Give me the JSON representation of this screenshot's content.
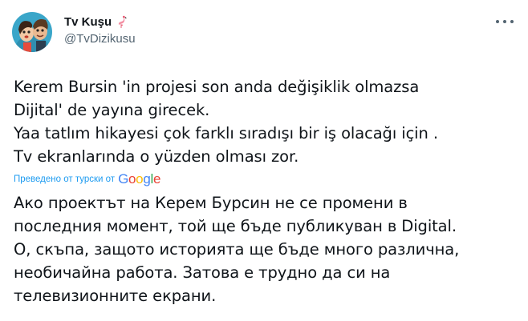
{
  "user": {
    "display_name": "Tv Kuşu",
    "handle": "@TvDizikusu",
    "name_emoji": "flamingo-icon"
  },
  "tweet": {
    "original_text": "Kerem Bursin 'in projesi son anda değişiklik olmazsa\nDijital' de yayına girecek.\nYaa tatlım hikayesi çok farklı sıradışı bir iş olacağı için .\nTv ekranlarında o yüzden olması zor.",
    "translated_by": "Преведено от турски от",
    "translator_logo": "Google",
    "translated_text": "Ако проектът на Керем Бурсин не се промени в\nпоследния момент, той ще бъде публикуван в Digital.\nО, скъпа, защото историята ще бъде много различна,\nнеобичайна работа. Затова е трудно да си на\nтелевизионните екрани."
  },
  "colors": {
    "link_blue": "#1d9bf0",
    "secondary_text": "#536471",
    "primary_text": "#0f1419"
  }
}
